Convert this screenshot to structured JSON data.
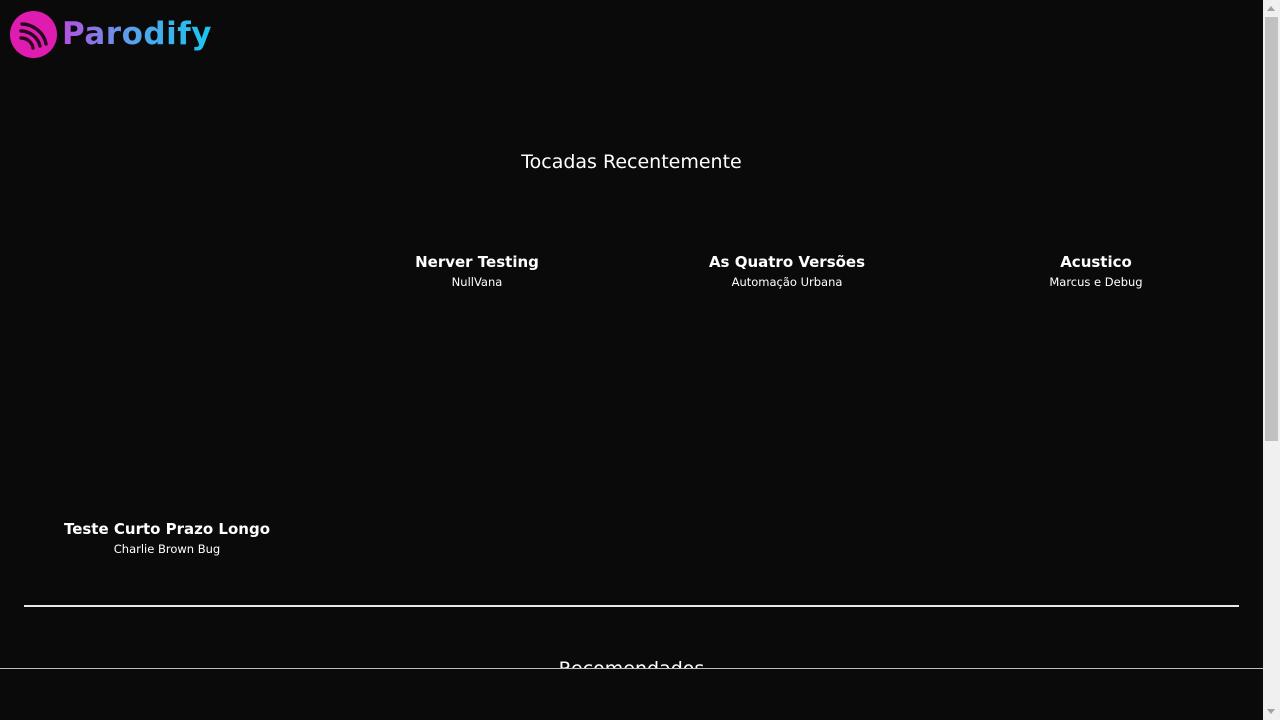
{
  "app": {
    "name": "Parodify",
    "brand_color": "#e01bb0",
    "logo_icon": "broadcast-waves-icon"
  },
  "recent": {
    "title": "Tocadas Recentemente",
    "tracks": [
      {
        "title": "Nerver Testing",
        "artist": "NullVana"
      },
      {
        "title": "As Quatro Versões",
        "artist": "Automação Urbana"
      },
      {
        "title": "Acustico",
        "artist": "Marcus e Debug"
      },
      {
        "title": "Teste Curto Prazo Longo",
        "artist": "Charlie Brown Bug"
      }
    ]
  },
  "recommended": {
    "title": "Recomendados"
  }
}
